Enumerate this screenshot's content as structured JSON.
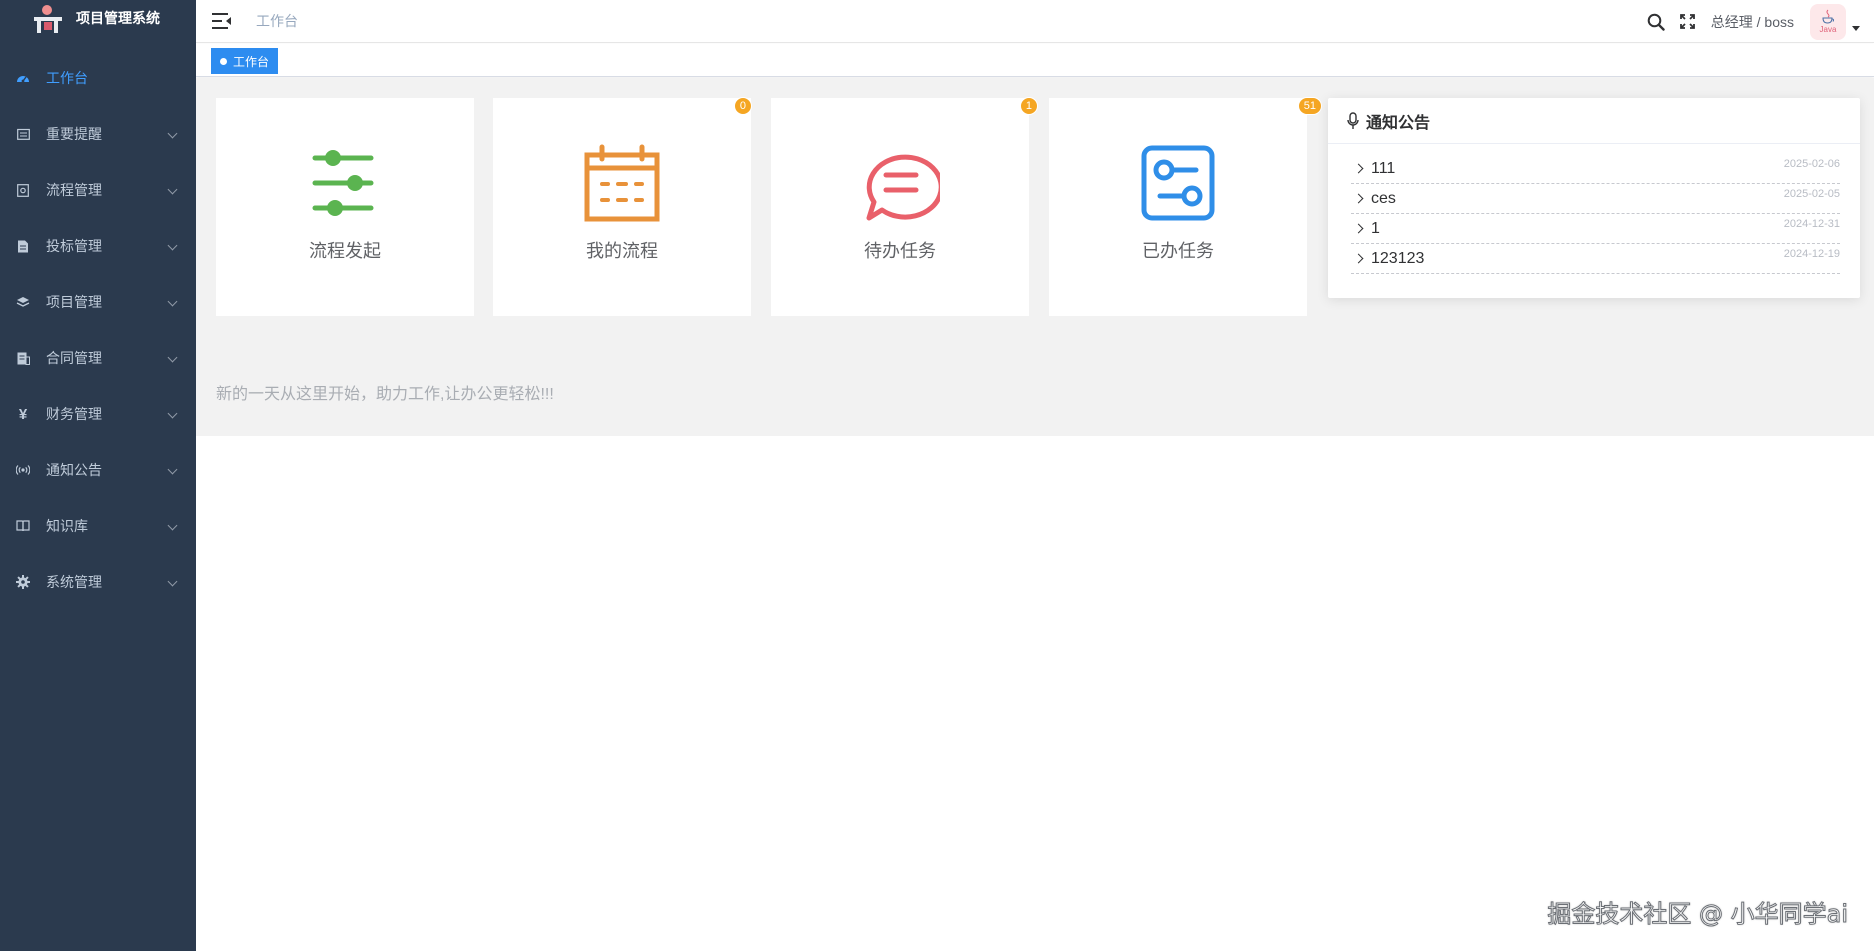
{
  "app": {
    "title": "项目管理系统"
  },
  "sidebar": {
    "items": [
      {
        "label": "工作台",
        "icon": "dashboard-icon",
        "active": true
      },
      {
        "label": "重要提醒",
        "icon": "calendar-icon"
      },
      {
        "label": "流程管理",
        "icon": "flow-icon"
      },
      {
        "label": "投标管理",
        "icon": "document-icon"
      },
      {
        "label": "项目管理",
        "icon": "layers-icon"
      },
      {
        "label": "合同管理",
        "icon": "contract-icon"
      },
      {
        "label": "财务管理",
        "icon": "yen-icon"
      },
      {
        "label": "通知公告",
        "icon": "broadcast-icon"
      },
      {
        "label": "知识库",
        "icon": "book-icon"
      },
      {
        "label": "系统管理",
        "icon": "gear-icon"
      }
    ]
  },
  "header": {
    "breadcrumb": "工作台",
    "user": "总经理 / boss",
    "avatar_text": "Java"
  },
  "tags": {
    "active": "工作台"
  },
  "cards": [
    {
      "label": "流程发起",
      "icon": "sliders-icon",
      "color": "#5bb450",
      "badge": null
    },
    {
      "label": "我的流程",
      "icon": "calendar-icon",
      "color": "#e8923a",
      "badge": "0"
    },
    {
      "label": "待办任务",
      "icon": "chat-icon",
      "color": "#e9606a",
      "badge": "1"
    },
    {
      "label": "已办任务",
      "icon": "toggle-icon",
      "color": "#2f8ee8",
      "badge": "51"
    }
  ],
  "notice": {
    "title": "通知公告",
    "items": [
      {
        "title": "111",
        "date": "2025-02-06"
      },
      {
        "title": "ces",
        "date": "2025-02-05"
      },
      {
        "title": "1",
        "date": "2024-12-31"
      },
      {
        "title": "123123",
        "date": "2024-12-19"
      }
    ]
  },
  "tagline": "新的一天从这里开始，助力工作,让办公更轻松!!!",
  "watermark": "掘金技术社区 @ 小华同学ai",
  "colors": {
    "sidebar_bg": "#2b3a4e",
    "accent": "#409eff",
    "tag_bg": "#2d8cf0",
    "badge": "#f5a623"
  }
}
